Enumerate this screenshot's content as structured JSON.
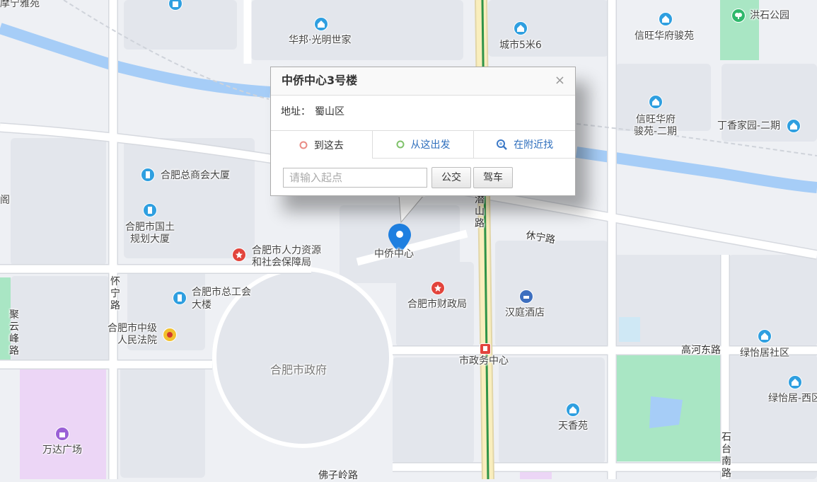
{
  "popup": {
    "title": "中侨中心3号楼",
    "close": "×",
    "address_label": "地址：",
    "address_value": "蜀山区",
    "tabs": [
      {
        "label": "到这去",
        "icon": "red-circle-icon",
        "color": "#e98b84"
      },
      {
        "label": "从这出发",
        "icon": "green-circle-icon",
        "color": "#7fc26a"
      },
      {
        "label": "在附近找",
        "icon": "magnifier-icon",
        "color": "#3c79c7"
      }
    ],
    "input_placeholder": "请输入起点",
    "bus_button": "公交",
    "drive_button": "驾车"
  },
  "marker": {
    "label": "中侨中心",
    "icon": "map-pin-icon",
    "color": "#1e7fe0"
  },
  "labels": {
    "ningya": "摩宁雅苑",
    "huabang": "华邦·光明世家",
    "city5m": "城市5米6",
    "xinwanghua": "信旺华府骏苑",
    "hongshi": "洪石公园",
    "xinwang2a": "信旺华府",
    "xinwang2b": "骏苑-二期",
    "dingxiang": "丁香家园-二期",
    "shanghui": "合肥总商会大厦",
    "guotu_a": "合肥市国土",
    "guotu_b": "规划大厦",
    "renli_a": "合肥市人力资源",
    "renli_b": "和社会保障局",
    "zonggonghui_a": "合肥市总工会",
    "zonggonghui_b": "大楼",
    "caizheng": "合肥市财政局",
    "hanting": "汉庭酒店",
    "zhongji_a": "合肥市中级",
    "zhongji_b": "人民法院",
    "government": "合肥市政府",
    "shizhengwu": "市政务中心",
    "gaohe": "高河东路",
    "lvyiju": "绿怡居社区",
    "lvyiju_w": "绿怡居-西区",
    "tianxiang": "天香苑",
    "wanda": "万达广场",
    "foziling": "佛子岭路",
    "qianshan": "潜山路",
    "xiuning": "休宁路",
    "huaining": "怀宁路",
    "juyunfeng": "聚云峰路",
    "shitai": "石台南路",
    "ge": "阁"
  },
  "colors": {
    "background": "#eef0f4",
    "block": "#e3e6ec",
    "road": "#ffffff",
    "road_edge": "#d6d9df",
    "water": "#a6cdf7",
    "park": "#a9e6c4",
    "purple_area": "#ecd6f6",
    "metro": "#2f9448",
    "main_road": "#f5e3a1"
  }
}
